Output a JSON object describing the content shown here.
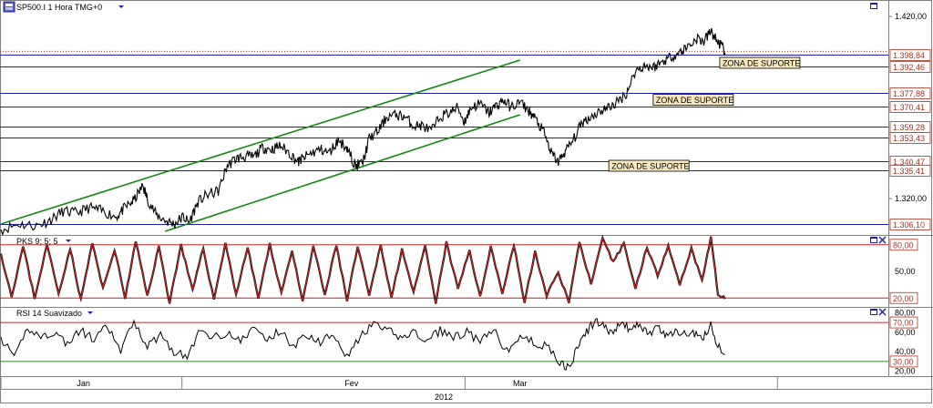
{
  "window": {
    "symbol_title": "SP500.I 1 Hora TMG+0"
  },
  "colors": {
    "price_line": "#000000",
    "support_line": "#1d1db0",
    "channel_line": "#128a12",
    "indicator_line": "#c22424",
    "overbought_line": "#c22424",
    "oversold_line": "#2a8a2a",
    "label_text": "#b03020",
    "zone_label_bg": "#f8e8c0"
  },
  "icons": [
    "window-maximize-icon",
    "close-icon",
    "symbol-icon",
    "dropdown-icon"
  ],
  "chart_data": [
    {
      "type": "line",
      "panel": "price",
      "title": "SP500.I 1 Hora TMG+0",
      "ylim": [
        1300,
        1428
      ],
      "y_ticks": [
        {
          "value": 1420,
          "label": "1.420,00"
        },
        {
          "value": 1320,
          "label": "1.320,00"
        }
      ],
      "current_price": 1398.84,
      "support_levels": [
        {
          "value": 1398.84,
          "label": "1.398,84"
        },
        {
          "value": 1392.46,
          "label": "1.392,46"
        },
        {
          "value": 1377.88,
          "label": "1.377,88"
        },
        {
          "value": 1370.41,
          "label": "1.370,41"
        },
        {
          "value": 1359.28,
          "label": "1.359,28"
        },
        {
          "value": 1353.43,
          "label": "1.353,43"
        },
        {
          "value": 1340.47,
          "label": "1.340,47"
        },
        {
          "value": 1335.41,
          "label": "1.335,41"
        },
        {
          "value": 1306.1,
          "label": "1.306,10"
        }
      ],
      "zone_labels": [
        {
          "text": "ZONA DE SUPORTE",
          "value": 1394.5,
          "t": 0.81
        },
        {
          "text": "ZONA DE SUPORTE",
          "value": 1374.2,
          "t": 0.735
        },
        {
          "text": "ZONA DE SUPORTE",
          "value": 1338.0,
          "t": 0.685
        }
      ],
      "channel_lines": [
        {
          "t0": 0.0,
          "v0": 1306.0,
          "t1": 0.585,
          "v1": 1396.0
        },
        {
          "t0": 0.185,
          "v0": 1302.0,
          "t1": 0.585,
          "v1": 1366.0
        }
      ],
      "series": [
        {
          "points": [
            [
              0.0,
              1303
            ],
            [
              0.02,
              1306
            ],
            [
              0.04,
              1305
            ],
            [
              0.055,
              1308
            ],
            [
              0.07,
              1313
            ],
            [
              0.085,
              1312
            ],
            [
              0.1,
              1315
            ],
            [
              0.115,
              1313
            ],
            [
              0.13,
              1310
            ],
            [
              0.14,
              1315
            ],
            [
              0.15,
              1319
            ],
            [
              0.16,
              1327
            ],
            [
              0.165,
              1320
            ],
            [
              0.175,
              1311
            ],
            [
              0.185,
              1308
            ],
            [
              0.195,
              1306
            ],
            [
              0.205,
              1310
            ],
            [
              0.212,
              1307
            ],
            [
              0.222,
              1318
            ],
            [
              0.232,
              1322
            ],
            [
              0.245,
              1324
            ],
            [
              0.255,
              1338
            ],
            [
              0.265,
              1342
            ],
            [
              0.275,
              1343
            ],
            [
              0.285,
              1343
            ],
            [
              0.295,
              1348
            ],
            [
              0.305,
              1347
            ],
            [
              0.315,
              1349
            ],
            [
              0.325,
              1345
            ],
            [
              0.335,
              1340
            ],
            [
              0.34,
              1342
            ],
            [
              0.35,
              1345
            ],
            [
              0.36,
              1347
            ],
            [
              0.37,
              1345
            ],
            [
              0.38,
              1352
            ],
            [
              0.39,
              1348
            ],
            [
              0.395,
              1342
            ],
            [
              0.4,
              1338
            ],
            [
              0.408,
              1340
            ],
            [
              0.415,
              1353
            ],
            [
              0.425,
              1357
            ],
            [
              0.435,
              1365
            ],
            [
              0.445,
              1366
            ],
            [
              0.455,
              1365
            ],
            [
              0.465,
              1360
            ],
            [
              0.475,
              1360
            ],
            [
              0.485,
              1357
            ],
            [
              0.495,
              1365
            ],
            [
              0.505,
              1367
            ],
            [
              0.515,
              1370
            ],
            [
              0.522,
              1362
            ],
            [
              0.53,
              1370
            ],
            [
              0.54,
              1372
            ],
            [
              0.55,
              1367
            ],
            [
              0.558,
              1371
            ],
            [
              0.566,
              1374
            ],
            [
              0.575,
              1370
            ],
            [
              0.585,
              1373
            ],
            [
              0.595,
              1368
            ],
            [
              0.602,
              1364
            ],
            [
              0.612,
              1356
            ],
            [
              0.62,
              1345
            ],
            [
              0.628,
              1340
            ],
            [
              0.636,
              1346
            ],
            [
              0.645,
              1352
            ],
            [
              0.655,
              1362
            ],
            [
              0.665,
              1365
            ],
            [
              0.675,
              1368
            ],
            [
              0.685,
              1370
            ],
            [
              0.695,
              1373
            ],
            [
              0.705,
              1378
            ],
            [
              0.715,
              1390
            ],
            [
              0.725,
              1393
            ],
            [
              0.735,
              1392
            ],
            [
              0.745,
              1395
            ],
            [
              0.755,
              1398
            ],
            [
              0.765,
              1400
            ],
            [
              0.775,
              1404
            ],
            [
              0.785,
              1408
            ],
            [
              0.792,
              1406
            ],
            [
              0.8,
              1412
            ],
            [
              0.806,
              1407
            ],
            [
              0.812,
              1404
            ],
            [
              0.816,
              1400
            ]
          ]
        }
      ]
    },
    {
      "type": "line",
      "panel": "oscillator",
      "title": "PKS 9; 5; 5",
      "ylim": [
        10,
        90
      ],
      "y_ticks": [
        {
          "value": 80,
          "label": "80,00"
        },
        {
          "value": 50,
          "label": "50,00"
        },
        {
          "value": 20,
          "label": "20,00"
        }
      ],
      "levels": [
        80,
        20
      ],
      "series": [
        {
          "points": [
            [
              0.0,
              70
            ],
            [
              0.012,
              22
            ],
            [
              0.025,
              78
            ],
            [
              0.038,
              20
            ],
            [
              0.052,
              80
            ],
            [
              0.065,
              25
            ],
            [
              0.078,
              76
            ],
            [
              0.09,
              18
            ],
            [
              0.103,
              82
            ],
            [
              0.115,
              30
            ],
            [
              0.128,
              75
            ],
            [
              0.14,
              20
            ],
            [
              0.152,
              84
            ],
            [
              0.165,
              22
            ],
            [
              0.178,
              78
            ],
            [
              0.19,
              15
            ],
            [
              0.203,
              80
            ],
            [
              0.216,
              28
            ],
            [
              0.228,
              76
            ],
            [
              0.24,
              18
            ],
            [
              0.253,
              82
            ],
            [
              0.265,
              24
            ],
            [
              0.278,
              77
            ],
            [
              0.29,
              20
            ],
            [
              0.303,
              80
            ],
            [
              0.316,
              26
            ],
            [
              0.328,
              74
            ],
            [
              0.34,
              15
            ],
            [
              0.352,
              79
            ],
            [
              0.365,
              23
            ],
            [
              0.378,
              80
            ],
            [
              0.39,
              17
            ],
            [
              0.402,
              78
            ],
            [
              0.415,
              22
            ],
            [
              0.428,
              80
            ],
            [
              0.44,
              20
            ],
            [
              0.452,
              76
            ],
            [
              0.465,
              25
            ],
            [
              0.478,
              78
            ],
            [
              0.49,
              14
            ],
            [
              0.502,
              82
            ],
            [
              0.515,
              30
            ],
            [
              0.528,
              74
            ],
            [
              0.54,
              20
            ],
            [
              0.552,
              79
            ],
            [
              0.565,
              25
            ],
            [
              0.578,
              80
            ],
            [
              0.59,
              15
            ],
            [
              0.602,
              72
            ],
            [
              0.615,
              22
            ],
            [
              0.628,
              50
            ],
            [
              0.64,
              15
            ],
            [
              0.652,
              84
            ],
            [
              0.665,
              35
            ],
            [
              0.678,
              86
            ],
            [
              0.69,
              60
            ],
            [
              0.702,
              82
            ],
            [
              0.715,
              30
            ],
            [
              0.728,
              78
            ],
            [
              0.74,
              45
            ],
            [
              0.752,
              80
            ],
            [
              0.765,
              35
            ],
            [
              0.778,
              76
            ],
            [
              0.79,
              40
            ],
            [
              0.8,
              88
            ],
            [
              0.808,
              25
            ],
            [
              0.816,
              19
            ]
          ]
        }
      ]
    },
    {
      "type": "line",
      "panel": "rsi",
      "title": "RSI 14 Suavizado",
      "ylim": [
        15,
        85
      ],
      "y_ticks": [
        {
          "value": 80,
          "label": "80,00"
        },
        {
          "value": 60,
          "label": "60,00"
        },
        {
          "value": 40,
          "label": "40,00"
        },
        {
          "value": 20,
          "label": "20,00"
        }
      ],
      "levels": [
        70,
        30
      ],
      "series": [
        {
          "points": [
            [
              0.0,
              55
            ],
            [
              0.015,
              32
            ],
            [
              0.03,
              65
            ],
            [
              0.045,
              55
            ],
            [
              0.06,
              60
            ],
            [
              0.075,
              48
            ],
            [
              0.09,
              62
            ],
            [
              0.105,
              52
            ],
            [
              0.12,
              66
            ],
            [
              0.135,
              40
            ],
            [
              0.15,
              72
            ],
            [
              0.165,
              45
            ],
            [
              0.18,
              58
            ],
            [
              0.195,
              40
            ],
            [
              0.21,
              35
            ],
            [
              0.225,
              62
            ],
            [
              0.24,
              55
            ],
            [
              0.255,
              60
            ],
            [
              0.27,
              50
            ],
            [
              0.285,
              65
            ],
            [
              0.3,
              52
            ],
            [
              0.315,
              62
            ],
            [
              0.33,
              45
            ],
            [
              0.345,
              58
            ],
            [
              0.36,
              50
            ],
            [
              0.375,
              60
            ],
            [
              0.39,
              35
            ],
            [
              0.405,
              55
            ],
            [
              0.42,
              68
            ],
            [
              0.435,
              62
            ],
            [
              0.45,
              55
            ],
            [
              0.465,
              60
            ],
            [
              0.48,
              50
            ],
            [
              0.495,
              62
            ],
            [
              0.51,
              55
            ],
            [
              0.525,
              60
            ],
            [
              0.54,
              50
            ],
            [
              0.555,
              62
            ],
            [
              0.57,
              40
            ],
            [
              0.585,
              55
            ],
            [
              0.6,
              50
            ],
            [
              0.615,
              45
            ],
            [
              0.63,
              30
            ],
            [
              0.64,
              22
            ],
            [
              0.65,
              45
            ],
            [
              0.66,
              60
            ],
            [
              0.67,
              72
            ],
            [
              0.68,
              65
            ],
            [
              0.69,
              60
            ],
            [
              0.7,
              70
            ],
            [
              0.71,
              62
            ],
            [
              0.72,
              68
            ],
            [
              0.73,
              58
            ],
            [
              0.74,
              65
            ],
            [
              0.75,
              55
            ],
            [
              0.76,
              62
            ],
            [
              0.77,
              58
            ],
            [
              0.78,
              60
            ],
            [
              0.79,
              52
            ],
            [
              0.8,
              68
            ],
            [
              0.808,
              45
            ],
            [
              0.816,
              37
            ]
          ]
        }
      ]
    }
  ],
  "x_axis": {
    "labels": [
      {
        "text": "Jan",
        "t": 0.093
      },
      {
        "text": "Fev",
        "t": 0.395
      },
      {
        "text": "Mar",
        "t": 0.585
      }
    ],
    "year": "2012"
  }
}
